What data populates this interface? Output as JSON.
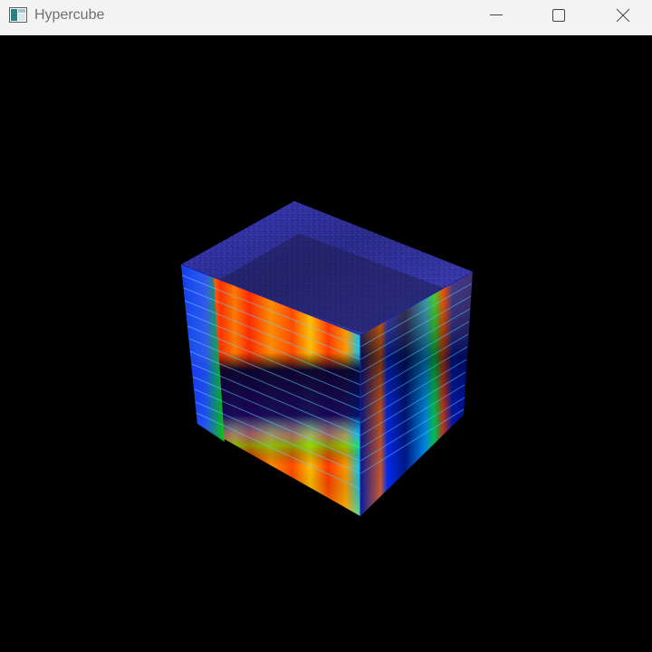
{
  "window": {
    "title": "Hypercube",
    "app_icon": "window-app-icon",
    "controls": {
      "minimize": "minimize-icon",
      "maximize": "maximize-icon",
      "close": "close-icon"
    }
  },
  "viewport": {
    "background": "#000000",
    "object": "hyperspectral-data-cube",
    "colormap": [
      "#2a2a9a",
      "#0000ff",
      "#00c8ff",
      "#00ff00",
      "#ffff00",
      "#ff8000",
      "#ff0000"
    ]
  }
}
